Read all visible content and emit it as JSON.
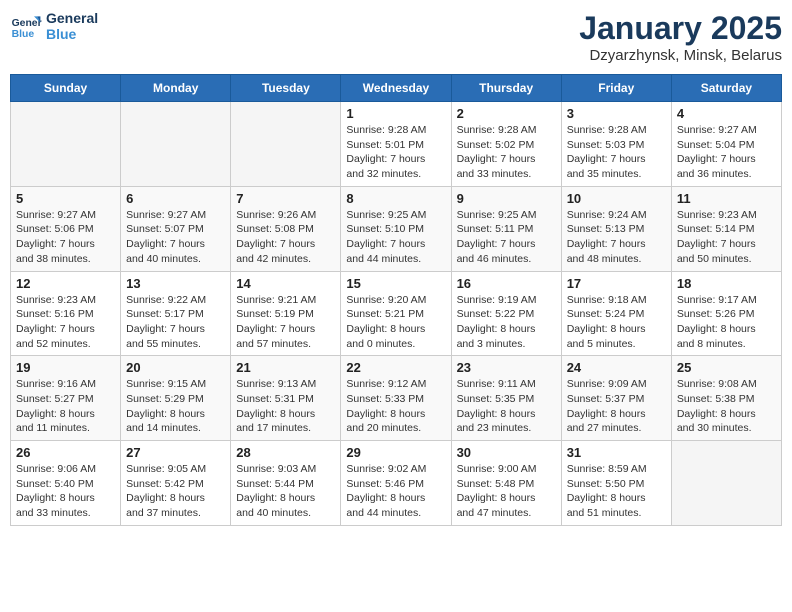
{
  "logo": {
    "line1": "General",
    "line2": "Blue"
  },
  "calendar": {
    "title": "January 2025",
    "subtitle": "Dzyarzhynsk, Minsk, Belarus"
  },
  "weekdays": [
    "Sunday",
    "Monday",
    "Tuesday",
    "Wednesday",
    "Thursday",
    "Friday",
    "Saturday"
  ],
  "weeks": [
    [
      {
        "day": "",
        "info": ""
      },
      {
        "day": "",
        "info": ""
      },
      {
        "day": "",
        "info": ""
      },
      {
        "day": "1",
        "info": "Sunrise: 9:28 AM\nSunset: 5:01 PM\nDaylight: 7 hours\nand 32 minutes."
      },
      {
        "day": "2",
        "info": "Sunrise: 9:28 AM\nSunset: 5:02 PM\nDaylight: 7 hours\nand 33 minutes."
      },
      {
        "day": "3",
        "info": "Sunrise: 9:28 AM\nSunset: 5:03 PM\nDaylight: 7 hours\nand 35 minutes."
      },
      {
        "day": "4",
        "info": "Sunrise: 9:27 AM\nSunset: 5:04 PM\nDaylight: 7 hours\nand 36 minutes."
      }
    ],
    [
      {
        "day": "5",
        "info": "Sunrise: 9:27 AM\nSunset: 5:06 PM\nDaylight: 7 hours\nand 38 minutes."
      },
      {
        "day": "6",
        "info": "Sunrise: 9:27 AM\nSunset: 5:07 PM\nDaylight: 7 hours\nand 40 minutes."
      },
      {
        "day": "7",
        "info": "Sunrise: 9:26 AM\nSunset: 5:08 PM\nDaylight: 7 hours\nand 42 minutes."
      },
      {
        "day": "8",
        "info": "Sunrise: 9:25 AM\nSunset: 5:10 PM\nDaylight: 7 hours\nand 44 minutes."
      },
      {
        "day": "9",
        "info": "Sunrise: 9:25 AM\nSunset: 5:11 PM\nDaylight: 7 hours\nand 46 minutes."
      },
      {
        "day": "10",
        "info": "Sunrise: 9:24 AM\nSunset: 5:13 PM\nDaylight: 7 hours\nand 48 minutes."
      },
      {
        "day": "11",
        "info": "Sunrise: 9:23 AM\nSunset: 5:14 PM\nDaylight: 7 hours\nand 50 minutes."
      }
    ],
    [
      {
        "day": "12",
        "info": "Sunrise: 9:23 AM\nSunset: 5:16 PM\nDaylight: 7 hours\nand 52 minutes."
      },
      {
        "day": "13",
        "info": "Sunrise: 9:22 AM\nSunset: 5:17 PM\nDaylight: 7 hours\nand 55 minutes."
      },
      {
        "day": "14",
        "info": "Sunrise: 9:21 AM\nSunset: 5:19 PM\nDaylight: 7 hours\nand 57 minutes."
      },
      {
        "day": "15",
        "info": "Sunrise: 9:20 AM\nSunset: 5:21 PM\nDaylight: 8 hours\nand 0 minutes."
      },
      {
        "day": "16",
        "info": "Sunrise: 9:19 AM\nSunset: 5:22 PM\nDaylight: 8 hours\nand 3 minutes."
      },
      {
        "day": "17",
        "info": "Sunrise: 9:18 AM\nSunset: 5:24 PM\nDaylight: 8 hours\nand 5 minutes."
      },
      {
        "day": "18",
        "info": "Sunrise: 9:17 AM\nSunset: 5:26 PM\nDaylight: 8 hours\nand 8 minutes."
      }
    ],
    [
      {
        "day": "19",
        "info": "Sunrise: 9:16 AM\nSunset: 5:27 PM\nDaylight: 8 hours\nand 11 minutes."
      },
      {
        "day": "20",
        "info": "Sunrise: 9:15 AM\nSunset: 5:29 PM\nDaylight: 8 hours\nand 14 minutes."
      },
      {
        "day": "21",
        "info": "Sunrise: 9:13 AM\nSunset: 5:31 PM\nDaylight: 8 hours\nand 17 minutes."
      },
      {
        "day": "22",
        "info": "Sunrise: 9:12 AM\nSunset: 5:33 PM\nDaylight: 8 hours\nand 20 minutes."
      },
      {
        "day": "23",
        "info": "Sunrise: 9:11 AM\nSunset: 5:35 PM\nDaylight: 8 hours\nand 23 minutes."
      },
      {
        "day": "24",
        "info": "Sunrise: 9:09 AM\nSunset: 5:37 PM\nDaylight: 8 hours\nand 27 minutes."
      },
      {
        "day": "25",
        "info": "Sunrise: 9:08 AM\nSunset: 5:38 PM\nDaylight: 8 hours\nand 30 minutes."
      }
    ],
    [
      {
        "day": "26",
        "info": "Sunrise: 9:06 AM\nSunset: 5:40 PM\nDaylight: 8 hours\nand 33 minutes."
      },
      {
        "day": "27",
        "info": "Sunrise: 9:05 AM\nSunset: 5:42 PM\nDaylight: 8 hours\nand 37 minutes."
      },
      {
        "day": "28",
        "info": "Sunrise: 9:03 AM\nSunset: 5:44 PM\nDaylight: 8 hours\nand 40 minutes."
      },
      {
        "day": "29",
        "info": "Sunrise: 9:02 AM\nSunset: 5:46 PM\nDaylight: 8 hours\nand 44 minutes."
      },
      {
        "day": "30",
        "info": "Sunrise: 9:00 AM\nSunset: 5:48 PM\nDaylight: 8 hours\nand 47 minutes."
      },
      {
        "day": "31",
        "info": "Sunrise: 8:59 AM\nSunset: 5:50 PM\nDaylight: 8 hours\nand 51 minutes."
      },
      {
        "day": "",
        "info": ""
      }
    ]
  ]
}
